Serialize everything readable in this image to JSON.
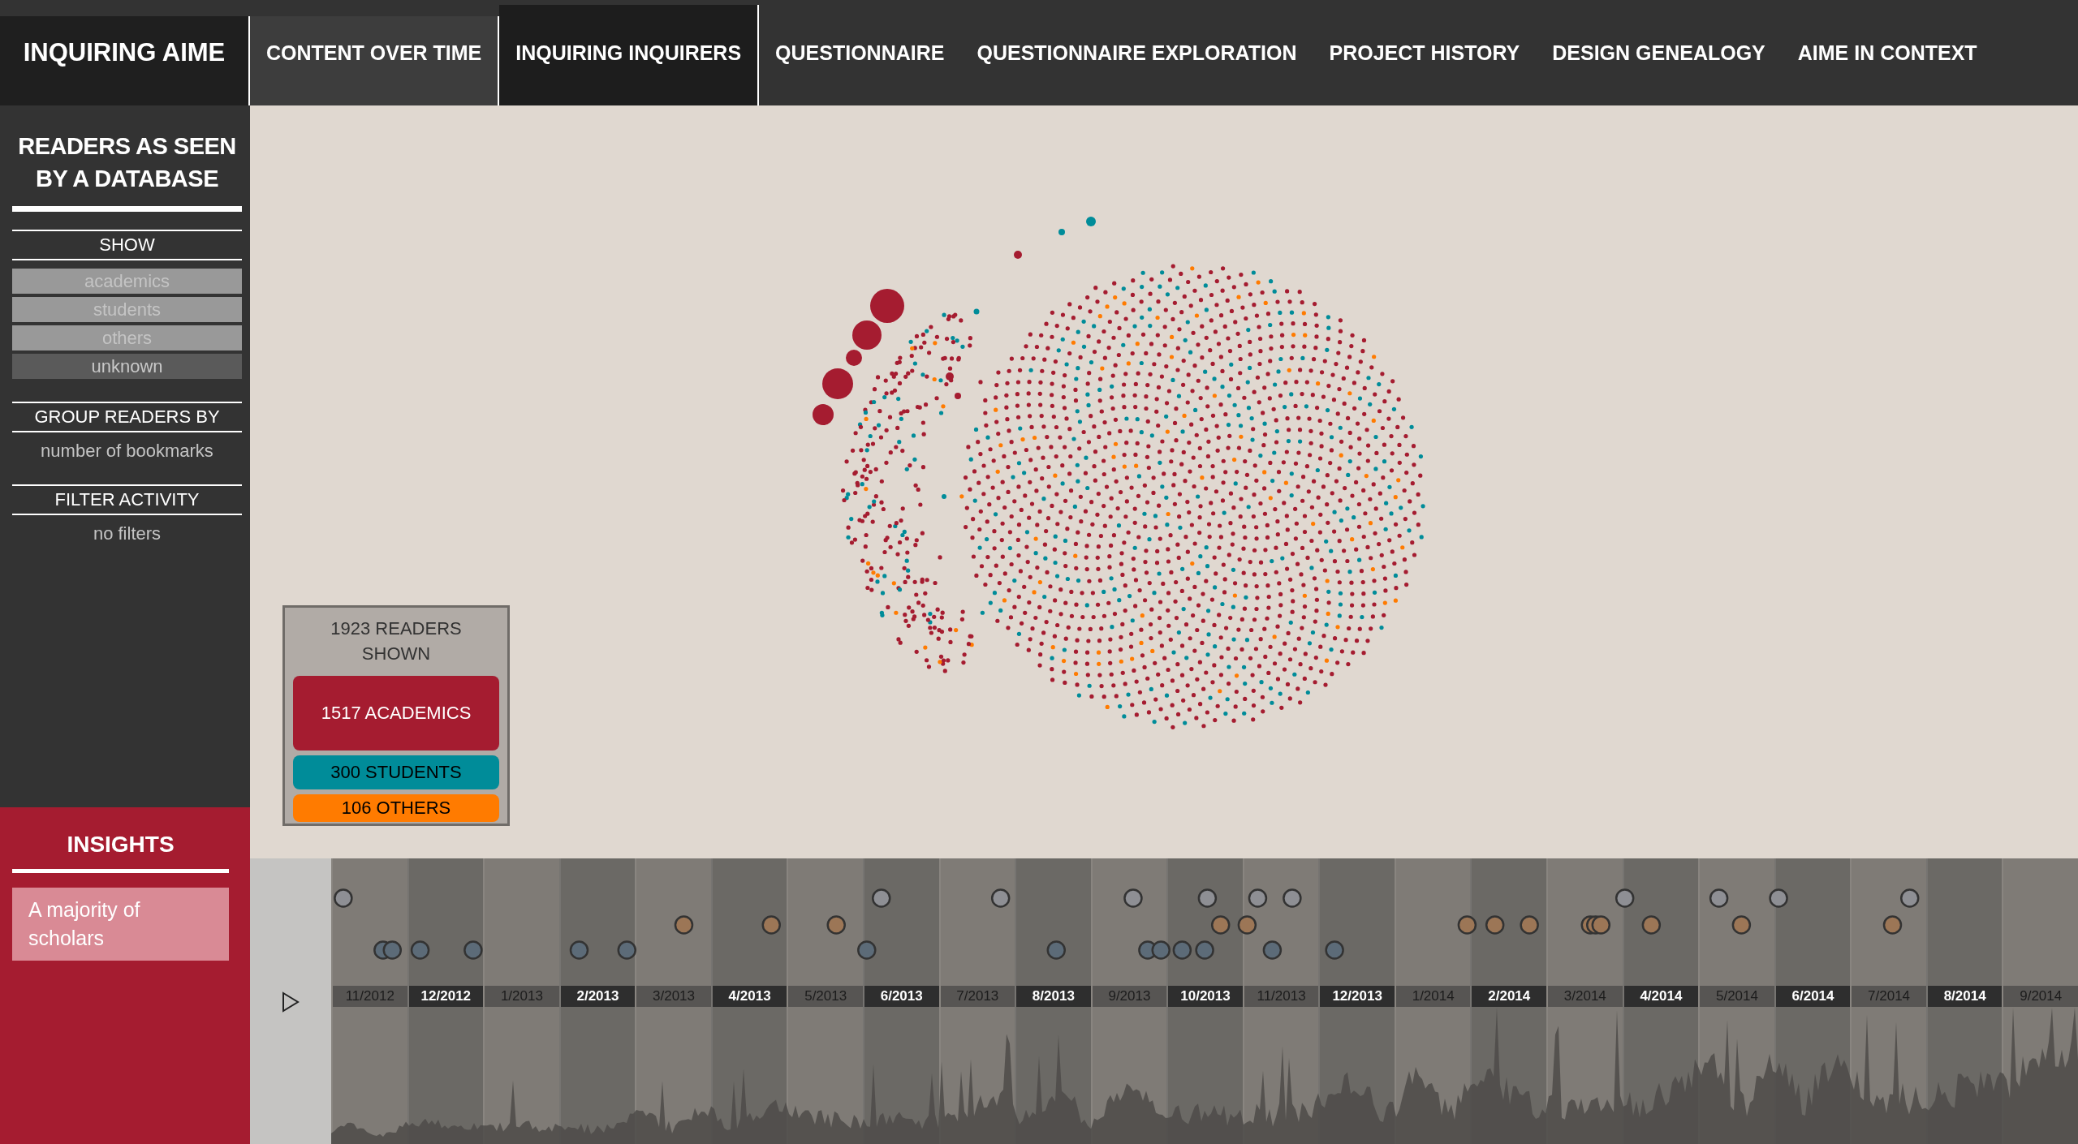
{
  "nav": {
    "brand": "INQUIRING AIME",
    "items": [
      {
        "label": "CONTENT OVER TIME",
        "selected": false,
        "highlighted": true
      },
      {
        "label": "INQUIRING INQUIRERS",
        "selected": true,
        "highlighted": false
      },
      {
        "label": "QUESTIONNAIRE",
        "selected": false,
        "highlighted": false
      },
      {
        "label": "QUESTIONNAIRE EXPLORATION",
        "selected": false,
        "highlighted": false
      },
      {
        "label": "PROJECT HISTORY",
        "selected": false,
        "highlighted": false
      },
      {
        "label": "DESIGN GENEALOGY",
        "selected": false,
        "highlighted": false
      },
      {
        "label": "AIME IN CONTEXT",
        "selected": false,
        "highlighted": false
      }
    ]
  },
  "sidebar": {
    "title": "READERS AS SEEN BY A DATABASE",
    "sections": [
      {
        "kind": "toggles",
        "heading": "SHOW",
        "options": [
          {
            "label": "academics",
            "on": true
          },
          {
            "label": "students",
            "on": true
          },
          {
            "label": "others",
            "on": true
          },
          {
            "label": "unknown",
            "on": false
          }
        ]
      },
      {
        "kind": "value",
        "heading": "GROUP READERS BY",
        "value": "number of bookmarks"
      },
      {
        "kind": "value",
        "heading": "FILTER ACTIVITY",
        "value": "no filters"
      }
    ]
  },
  "insights": {
    "title": "INSIGHTS",
    "cards": [
      "A majority of scholars"
    ]
  },
  "legend": {
    "total": "1923 READERS SHOWN",
    "groups": [
      {
        "label": "1517 ACADEMICS",
        "color": "#a51c30"
      },
      {
        "label": "300 STUDENTS",
        "color": "#008c99"
      },
      {
        "label": "106 OTHERS",
        "color": "#ff7b00"
      }
    ]
  },
  "timeline": {
    "months": [
      "11/2012",
      "12/2012",
      "1/2013",
      "2/2013",
      "3/2013",
      "4/2013",
      "5/2013",
      "6/2013",
      "7/2013",
      "8/2013",
      "9/2013",
      "10/2013",
      "11/2013",
      "12/2013",
      "1/2014",
      "2/2014",
      "3/2014",
      "4/2014",
      "5/2014",
      "6/2014",
      "7/2014",
      "8/2014",
      "9/2014"
    ]
  }
}
